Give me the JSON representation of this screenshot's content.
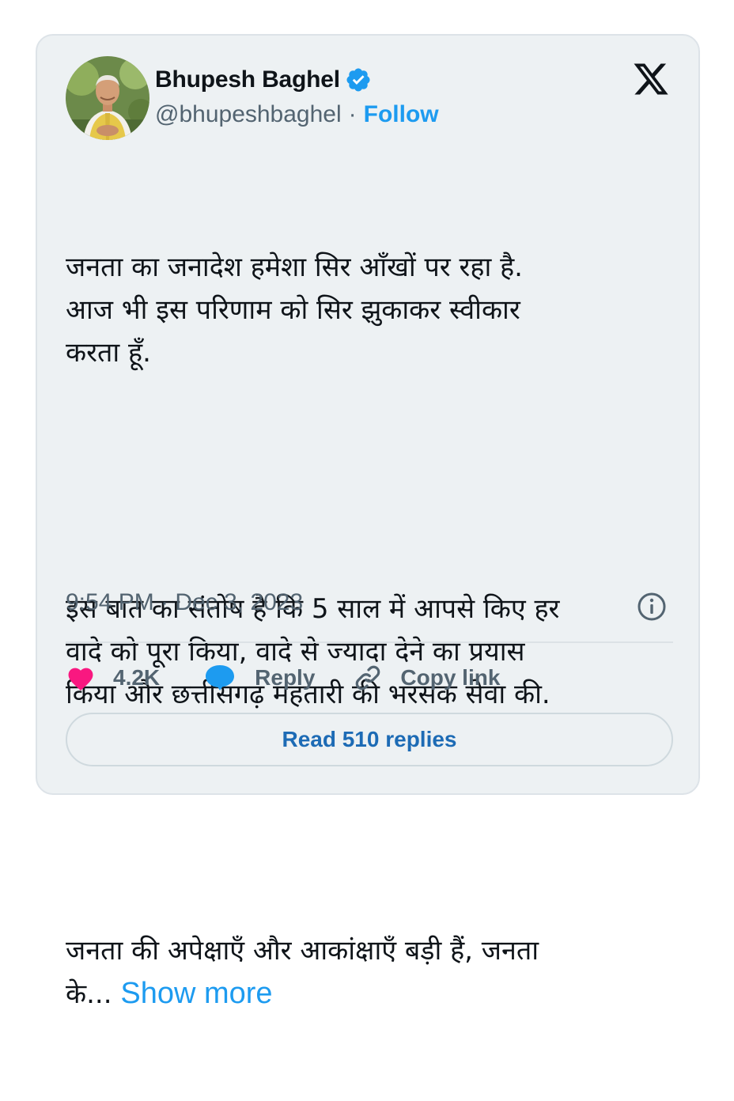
{
  "author": {
    "display_name": "Bhupesh Baghel",
    "handle": "@bhupeshbaghel",
    "separator": "·",
    "follow_label": "Follow",
    "verified": true
  },
  "brand": {
    "logo_icon": "x-logo-icon"
  },
  "tweet": {
    "paragraphs": [
      "जनता का जनादेश हमेशा सिर आँखों पर रहा है.\nआज भी इस परिणाम को सिर झुकाकर स्वीकार\nकरता हूँ.",
      "इस बात का संतोष है कि 5 साल में आपसे किए हर\nवादे को पूरा किया, वादे से ज्यादा देने का प्रयास\nकिया और छत्तीसगढ़ महतारी की भरसक सेवा की.",
      "जनता की अपेक्षाएँ और आकांक्षाएँ बड़ी हैं, जनता\nके..."
    ],
    "show_more_label": "Show more",
    "timestamp": "9:54 PM · Dec 3, 2023"
  },
  "actions": {
    "like_count": "4.2K",
    "reply_label": "Reply",
    "copy_link_label": "Copy link"
  },
  "footer": {
    "read_replies_label": "Read 510 replies"
  },
  "colors": {
    "card_background": "#edf1f3",
    "accent": "#1d9bf0",
    "like": "#f91880",
    "text_primary": "#0f1419",
    "text_secondary": "#536471"
  }
}
